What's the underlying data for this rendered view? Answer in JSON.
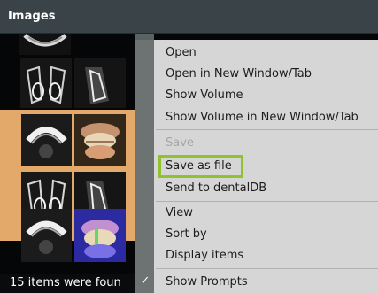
{
  "header": {
    "title": "Images"
  },
  "status": {
    "text": "15 items were foun"
  },
  "context_menu": {
    "groups": [
      {
        "items": [
          {
            "label": "Open",
            "enabled": true
          },
          {
            "label": "Open in New Window/Tab",
            "enabled": true
          },
          {
            "label": "Show Volume",
            "enabled": true
          },
          {
            "label": "Show Volume in New Window/Tab",
            "enabled": true
          }
        ]
      },
      {
        "items": [
          {
            "label": "Save",
            "enabled": false
          },
          {
            "label": "Save as file",
            "enabled": true,
            "highlighted": true
          },
          {
            "label": "Send to dentalDB",
            "enabled": true
          }
        ]
      },
      {
        "items": [
          {
            "label": "View",
            "enabled": true
          },
          {
            "label": "Sort by",
            "enabled": true
          },
          {
            "label": "Display items",
            "enabled": true
          }
        ]
      },
      {
        "items": [
          {
            "label": "Show Prompts",
            "enabled": true,
            "checked": true,
            "icon": "check-icon"
          }
        ]
      }
    ]
  },
  "colors": {
    "highlight_border": "#8fc22c",
    "selected_row": "#e2a96a",
    "menu_bg": "#d6d6d6",
    "header_bg": "#3a4448"
  }
}
